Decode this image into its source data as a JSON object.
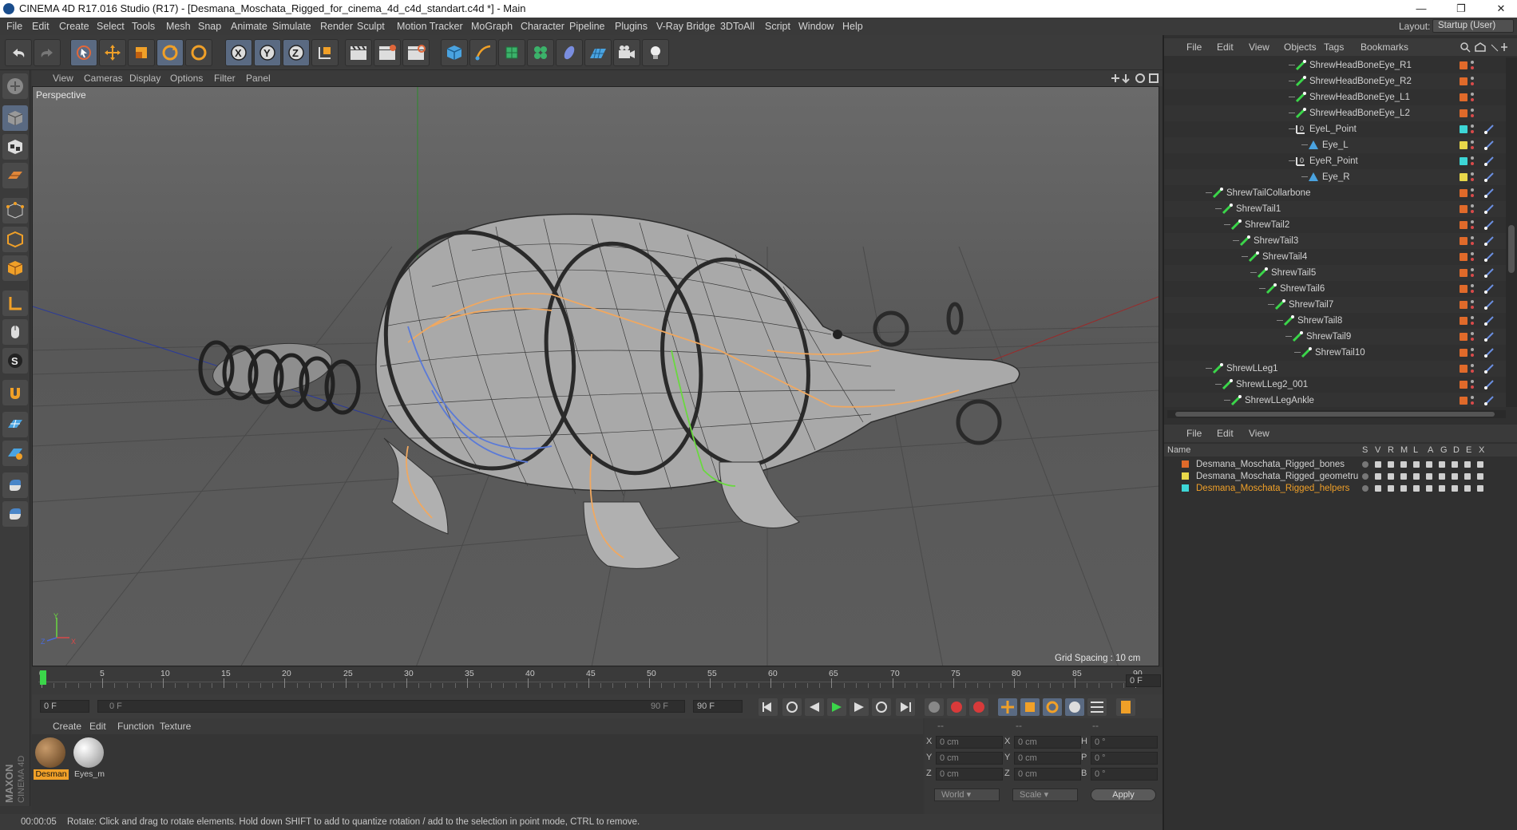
{
  "window": {
    "title": "CINEMA 4D R17.016 Studio (R17) - [Desmana_Moschata_Rigged_for_cinema_4d_c4d_standart.c4d *] - Main"
  },
  "menubar": [
    "File",
    "Edit",
    "Create",
    "Select",
    "Tools",
    "Mesh",
    "Snap",
    "Animate",
    "Simulate",
    "Render",
    "Sculpt",
    "Motion Tracker",
    "MoGraph",
    "Character",
    "Pipeline",
    "Plugins",
    "V-Ray Bridge",
    "3DToAll",
    "Script",
    "Window",
    "Help"
  ],
  "layout": {
    "label": "Layout:",
    "value": "Startup (User)"
  },
  "viewport": {
    "menu": [
      "View",
      "Cameras",
      "Display",
      "Options",
      "Filter",
      "Panel"
    ],
    "label": "Perspective",
    "grid_spacing": "Grid Spacing : 10 cm",
    "axis_labels": {
      "y": "Y",
      "z": "Z",
      "x": "X"
    }
  },
  "timeline": {
    "ticks": [
      "0",
      "5",
      "10",
      "15",
      "20",
      "25",
      "30",
      "35",
      "40",
      "45",
      "50",
      "55",
      "60",
      "65",
      "70",
      "75",
      "80",
      "85",
      "90"
    ],
    "end_frame": "0 F",
    "current_frame": "0 F",
    "range_start": "0 F",
    "range_end": "90 F",
    "max_frame": "90 F"
  },
  "material_panel": {
    "menu": [
      "Create",
      "Edit",
      "Function",
      "Texture"
    ],
    "materials": [
      {
        "label": "Desman"
      },
      {
        "label": "Eyes_m"
      }
    ]
  },
  "coords": {
    "header": [
      "--",
      "--",
      "--"
    ],
    "rows": [
      {
        "a": "X",
        "av": "0 cm",
        "b": "X",
        "bv": "0 cm",
        "c": "H",
        "cv": "0 °"
      },
      {
        "a": "Y",
        "av": "0 cm",
        "b": "Y",
        "bv": "0 cm",
        "c": "P",
        "cv": "0 °"
      },
      {
        "a": "Z",
        "av": "0 cm",
        "b": "Z",
        "bv": "0 cm",
        "c": "B",
        "cv": "0 °"
      }
    ],
    "world": "World",
    "scale": "Scale",
    "apply": "Apply"
  },
  "status": {
    "time": "00:00:05",
    "message": "Rotate: Click and drag to rotate elements. Hold down SHIFT to add to quantize rotation / add to the selection in point mode, CTRL to remove."
  },
  "object_manager": {
    "menu": [
      "File",
      "Edit",
      "View",
      "Objects",
      "Tags",
      "Bookmarks"
    ],
    "rows": [
      {
        "name": "ShrewHeadBoneEye_R1",
        "indent": 178,
        "color": "#e06a2a",
        "kind": "bone"
      },
      {
        "name": "ShrewHeadBoneEye_R2",
        "indent": 178,
        "color": "#e06a2a",
        "kind": "bone"
      },
      {
        "name": "ShrewHeadBoneEye_L1",
        "indent": 178,
        "color": "#e06a2a",
        "kind": "bone"
      },
      {
        "name": "ShrewHeadBoneEye_L2",
        "indent": 178,
        "color": "#e06a2a",
        "kind": "bone"
      },
      {
        "name": "EyeL_Point",
        "indent": 178,
        "color": "#3dd6d6",
        "kind": "null"
      },
      {
        "name": "Eye_L",
        "indent": 194,
        "color": "#e8d84a",
        "kind": "mesh"
      },
      {
        "name": "EyeR_Point",
        "indent": 178,
        "color": "#3dd6d6",
        "kind": "null"
      },
      {
        "name": "Eye_R",
        "indent": 194,
        "color": "#e8d84a",
        "kind": "mesh"
      },
      {
        "name": "ShrewTailCollarbone",
        "indent": 74,
        "color": "#e06a2a",
        "kind": "bone"
      },
      {
        "name": "ShrewTail1",
        "indent": 86,
        "color": "#e06a2a",
        "kind": "bone"
      },
      {
        "name": "ShrewTail2",
        "indent": 97,
        "color": "#e06a2a",
        "kind": "bone"
      },
      {
        "name": "ShrewTail3",
        "indent": 108,
        "color": "#e06a2a",
        "kind": "bone"
      },
      {
        "name": "ShrewTail4",
        "indent": 119,
        "color": "#e06a2a",
        "kind": "bone"
      },
      {
        "name": "ShrewTail5",
        "indent": 130,
        "color": "#e06a2a",
        "kind": "bone"
      },
      {
        "name": "ShrewTail6",
        "indent": 141,
        "color": "#e06a2a",
        "kind": "bone"
      },
      {
        "name": "ShrewTail7",
        "indent": 152,
        "color": "#e06a2a",
        "kind": "bone"
      },
      {
        "name": "ShrewTail8",
        "indent": 163,
        "color": "#e06a2a",
        "kind": "bone"
      },
      {
        "name": "ShrewTail9",
        "indent": 174,
        "color": "#e06a2a",
        "kind": "bone"
      },
      {
        "name": "ShrewTail10",
        "indent": 185,
        "color": "#e06a2a",
        "kind": "bone"
      },
      {
        "name": "ShrewLLeg1",
        "indent": 74,
        "color": "#e06a2a",
        "kind": "bone"
      },
      {
        "name": "ShrewLLeg2_001",
        "indent": 86,
        "color": "#e06a2a",
        "kind": "bone"
      },
      {
        "name": "ShrewLLegAnkle",
        "indent": 97,
        "color": "#e06a2a",
        "kind": "bone"
      }
    ]
  },
  "layer_manager": {
    "menu": [
      "File",
      "Edit",
      "View"
    ],
    "columns": [
      "Name",
      "S",
      "V",
      "R",
      "M",
      "L",
      "A",
      "G",
      "D",
      "E",
      "X"
    ],
    "layers": [
      {
        "name": "Desmana_Moschata_Rigged_bones",
        "color": "#e06a2a",
        "active": false
      },
      {
        "name": "Desmana_Moschata_Rigged_geometru",
        "color": "#e8d84a",
        "active": false
      },
      {
        "name": "Desmana_Moschata_Rigged_helpers",
        "color": "#3dd6d6",
        "active": true
      }
    ]
  },
  "sidebar_brand": "MAXON CINEMA 4D"
}
